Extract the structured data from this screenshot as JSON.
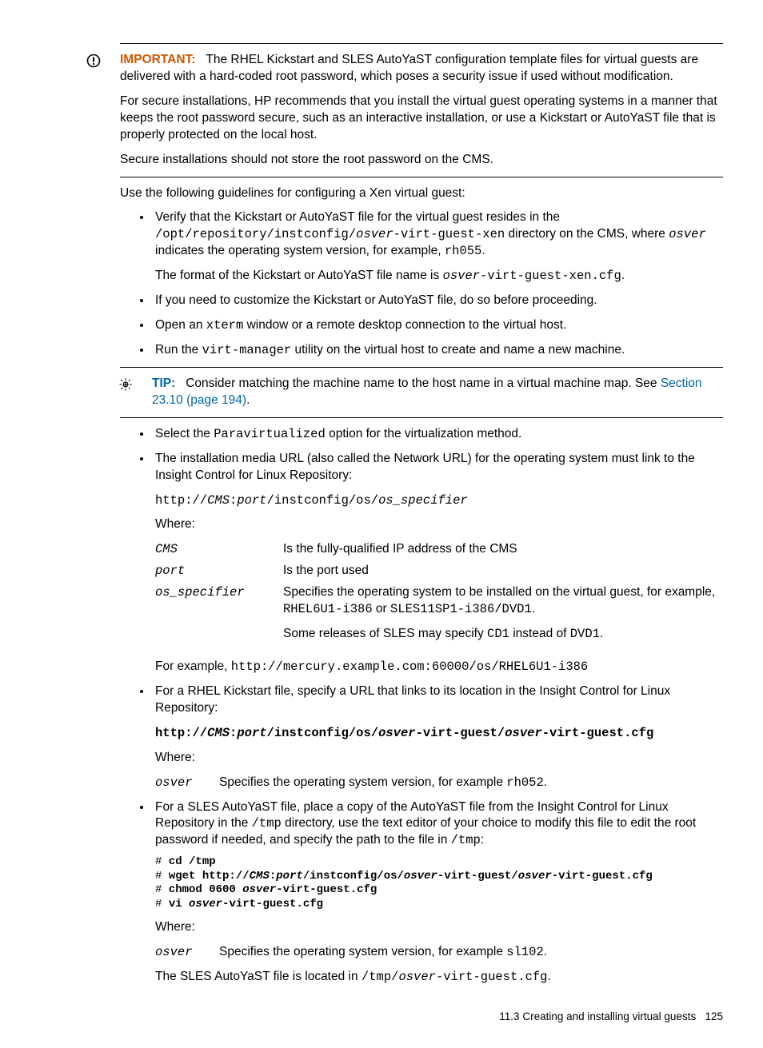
{
  "important": {
    "label": "IMPORTANT:",
    "p1a": "The RHEL Kickstart and SLES AutoYaST configuration template files for virtual guests are delivered with a hard-coded root password, which poses a security issue if used without modification.",
    "p2": "For secure installations, HP recommends that you install the virtual guest operating systems in a manner that keeps the root password secure, such as an interactive installation, or use a Kickstart or AutoYaST file that is properly protected on the local host.",
    "p3": "Secure installations should not store the root password on the CMS."
  },
  "intro": "Use the following guidelines for configuring a Xen virtual guest:",
  "b1": {
    "t1": "Verify that the Kickstart or AutoYaST file for the virtual guest resides in the ",
    "path1a": "/opt/repository/instconfig/",
    "path1b": "osver",
    "path1c": "-virt-guest-xen",
    "t2": " directory on the CMS, where ",
    "osver": "osver",
    "t3": " indicates the operating system version, for example, ",
    "ex": "rh055",
    "t4": ".",
    "p2a": "The format of the Kickstart or AutoYaST file name is ",
    "p2b": "osver",
    "p2c": "-virt-guest-xen.cfg",
    "p2d": "."
  },
  "b2": "If you need to customize the Kickstart or AutoYaST file, do so before proceeding.",
  "b3": {
    "a": "Open an ",
    "b": "xterm",
    "c": " window or a remote desktop connection to the virtual host."
  },
  "b4": {
    "a": "Run the ",
    "b": "virt-manager",
    "c": " utility on the virtual host to create and name a new machine."
  },
  "tip": {
    "label": "TIP:",
    "t1": "Consider matching the machine name to the host name in a virtual machine map. See ",
    "link": "Section 23.10 (page 194)",
    "t2": "."
  },
  "b5": {
    "a": "Select the ",
    "b": "Paravirtualized",
    "c": " option for the virtualization method."
  },
  "b6": {
    "p1": "The installation media URL (also called the Network URL) for the operating system must link to the Insight Control for Linux Repository:",
    "url_a": "http://",
    "url_b": "CMS",
    "url_c": ":",
    "url_d": "port",
    "url_e": "/instconfig/os/",
    "url_f": "os_specifier",
    "where": "Where:",
    "r1t": "CMS",
    "r1d": "Is the fully-qualified IP address of the CMS",
    "r2t": "port",
    "r2d": "Is the port used",
    "r3t": "os_specifier",
    "r3d_a": "Specifies the operating system to be installed on the virtual guest, for example, ",
    "r3d_b": "RHEL6U1-i386",
    "r3d_c": " or ",
    "r3d_d": "SLES11SP1-i386/DVD1",
    "r3d_e": ".",
    "r3p2_a": "Some releases of SLES may specify ",
    "r3p2_b": "CD1",
    "r3p2_c": " instead of ",
    "r3p2_d": "DVD1",
    "r3p2_e": ".",
    "ex_a": "For example, ",
    "ex_b": "http://mercury.example.com:60000/os/RHEL6U1-i386"
  },
  "b7": {
    "p1": "For a RHEL Kickstart file, specify a URL that links to its location in the Insight Control for Linux Repository:",
    "u1": "http://",
    "u2": "CMS",
    "u3": ":",
    "u4": "port",
    "u5": "/instconfig/os/",
    "u6": "osver",
    "u7": "-virt-guest/",
    "u8": "osver",
    "u9": "-virt-guest.cfg",
    "where": "Where:",
    "rt": "osver",
    "rd_a": "Specifies the operating system version, for example ",
    "rd_b": "rh052",
    "rd_c": "."
  },
  "b8": {
    "p1_a": "For a SLES AutoYaST file, place a copy of the AutoYaST file from the Insight Control for Linux Repository in the ",
    "p1_b": "/tmp",
    "p1_c": " directory, use the text editor of your choice to modify this file to edit the root password if needed, and specify the path to the file in ",
    "p1_d": "/tmp",
    "p1_e": ":",
    "where": "Where:",
    "rt": "osver",
    "rd_a": "Specifies the operating system version, for example ",
    "rd_b": "sl102",
    "rd_c": ".",
    "p3_a": "The SLES AutoYaST file is located in ",
    "p3_b": "/tmp/",
    "p3_c": "osver",
    "p3_d": "-virt-guest.cfg",
    "p3_e": "."
  },
  "footer": {
    "section": "11.3 Creating and installing virtual guests",
    "page": "125"
  }
}
